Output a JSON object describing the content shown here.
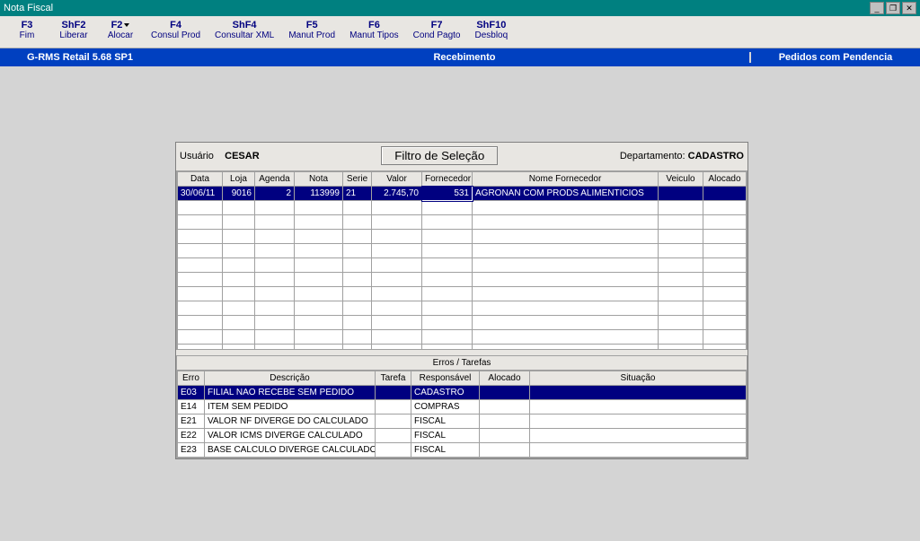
{
  "window": {
    "title": "Nota Fiscal"
  },
  "toolbar": [
    {
      "key": "F3",
      "label": "Fim"
    },
    {
      "key": "ShF2",
      "label": "Liberar"
    },
    {
      "key": "F2",
      "label": "Alocar",
      "dropdown": true
    },
    {
      "key": "F4",
      "label": "Consul Prod"
    },
    {
      "key": "ShF4",
      "label": "Consultar XML"
    },
    {
      "key": "F5",
      "label": "Manut Prod"
    },
    {
      "key": "F6",
      "label": "Manut Tipos"
    },
    {
      "key": "F7",
      "label": "Cond Pagto"
    },
    {
      "key": "ShF10",
      "label": "Desbloq"
    }
  ],
  "status": {
    "left": "G-RMS Retail 5.68 SP1",
    "center": "Recebimento",
    "right": "Pedidos com Pendencia"
  },
  "panel": {
    "user_label": "Usuário",
    "user_value": "CESAR",
    "filter_button": "Filtro de Seleção",
    "dept_label": "Departamento:",
    "dept_value": "CADASTRO"
  },
  "grid1": {
    "headers": [
      "Data",
      "Loja",
      "Agenda",
      "Nota",
      "Serie",
      "Valor",
      "Fornecedor",
      "Nome Fornecedor",
      "Veiculo",
      "Alocado"
    ],
    "rows": [
      {
        "data": "30/06/11",
        "loja": "9016",
        "agenda": "2",
        "nota": "113999",
        "serie": "21",
        "valor": "2.745,70",
        "fornecedor": "531",
        "nome": "AGRONAN COM PRODS ALIMENTICIOS",
        "veiculo": "",
        "alocado": ""
      }
    ],
    "empty_rows": 11
  },
  "errors": {
    "title": "Erros / Tarefas",
    "headers": [
      "Erro",
      "Descrição",
      "Tarefa",
      "Responsável",
      "Alocado",
      "Situação"
    ],
    "rows": [
      {
        "erro": "E03",
        "descricao": "FILIAL NAO RECEBE SEM PEDIDO",
        "tarefa": "",
        "resp": "CADASTRO",
        "alocado": "",
        "situacao": "",
        "selected": true
      },
      {
        "erro": "E14",
        "descricao": "ITEM SEM PEDIDO",
        "tarefa": "",
        "resp": "COMPRAS",
        "alocado": "",
        "situacao": ""
      },
      {
        "erro": "E21",
        "descricao": "VALOR NF DIVERGE DO CALCULADO",
        "tarefa": "",
        "resp": "FISCAL",
        "alocado": "",
        "situacao": ""
      },
      {
        "erro": "E22",
        "descricao": "VALOR ICMS DIVERGE CALCULADO",
        "tarefa": "",
        "resp": "FISCAL",
        "alocado": "",
        "situacao": ""
      },
      {
        "erro": "E23",
        "descricao": "BASE CALCULO DIVERGE CALCULADO",
        "tarefa": "",
        "resp": "FISCAL",
        "alocado": "",
        "situacao": ""
      }
    ]
  }
}
